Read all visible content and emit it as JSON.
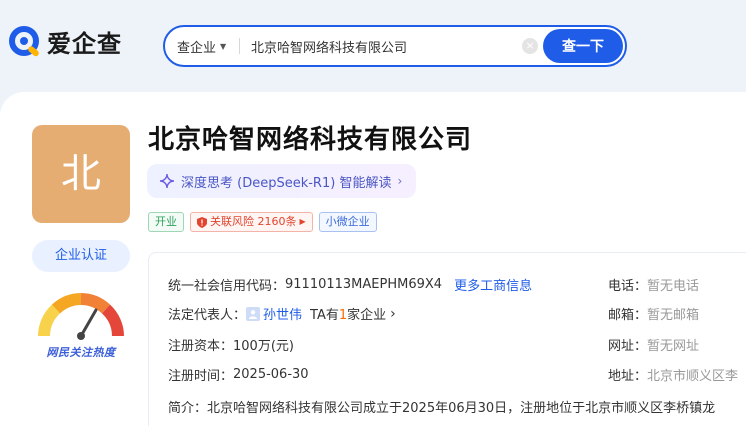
{
  "header": {
    "logo_text": "爱企查",
    "search_type": "查企业",
    "search_value": "北京哈智网络科技有限公司",
    "search_button": "查一下",
    "clear_icon": "×"
  },
  "company": {
    "avatar_char": "北",
    "name": "北京哈智网络科技有限公司",
    "verify_button": "企业认证",
    "heat_label": "网民关注热度",
    "ai_summary": "深度思考 (DeepSeek-R1) 智能解读",
    "tags": {
      "status": "开业",
      "risk": "关联风险 2160条",
      "scale": "小微企业"
    }
  },
  "info": {
    "credit_code_label": "统一社会信用代码：",
    "credit_code": "91110113MAEPHM69X4",
    "more_link": "更多工商信息",
    "legal_rep_label": "法定代表人：",
    "legal_rep": "孙世伟",
    "ta_prefix": "TA有",
    "ta_count": "1",
    "ta_suffix": "家企业",
    "capital_label": "注册资本：",
    "capital": "100万(元)",
    "reg_date_label": "注册时间：",
    "reg_date": "2025-06-30",
    "phone_label": "电话：",
    "phone": "暂无电话",
    "email_label": "邮箱：",
    "email": "暂无邮箱",
    "website_label": "网址：",
    "website": "暂无网址",
    "address_label": "地址：",
    "address": "北京市顺义区李",
    "intro_label": "简介：",
    "intro": "北京哈智网络科技有限公司成立于2025年06月30日，注册地位于北京市顺义区李桥镇龙"
  },
  "colors": {
    "brand": "#1f5de8",
    "avatar_bg": "#e6ad73",
    "risk": "#e2442f",
    "status_green": "#2ea05c"
  }
}
